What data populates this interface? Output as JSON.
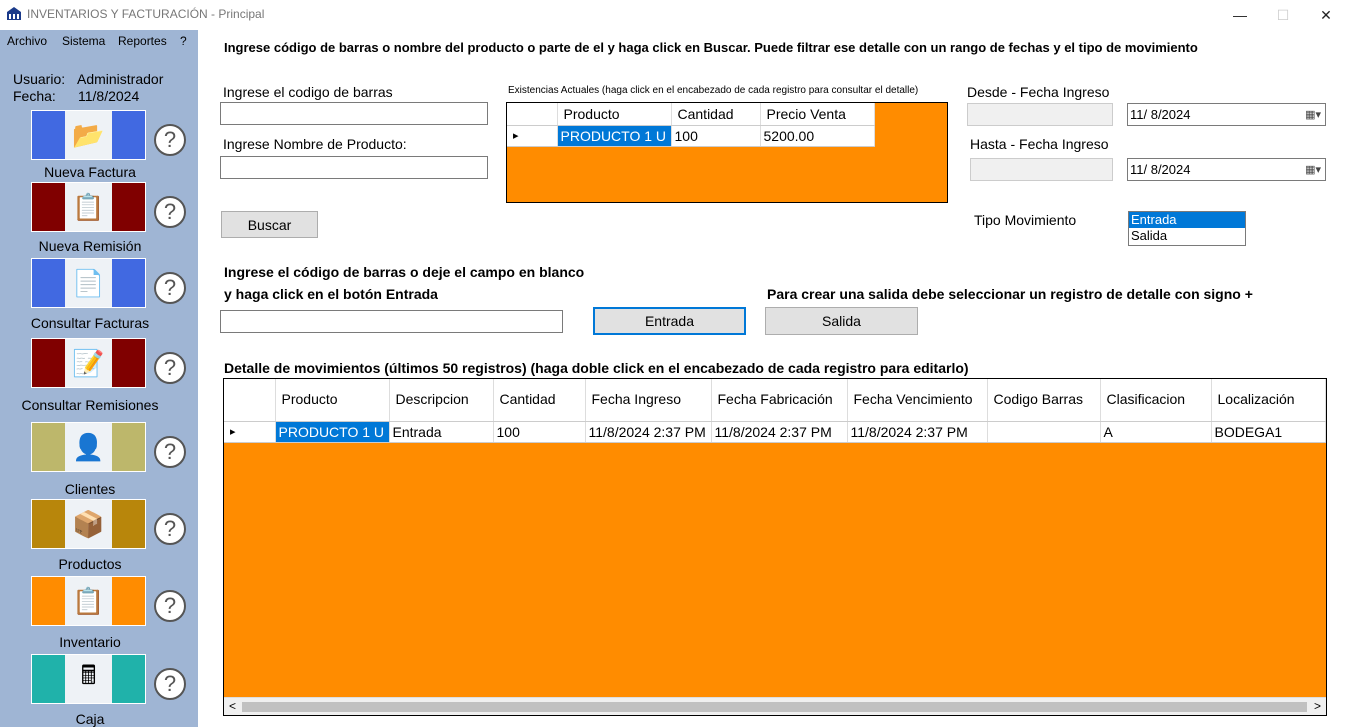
{
  "window": {
    "title": "INVENTARIOS Y FACTURACIÓN - Principal",
    "minimize": "—",
    "maximize": "☐",
    "close": "✕"
  },
  "menu": [
    "Archivo",
    "Sistema",
    "Reportes",
    "?"
  ],
  "user": {
    "user_label": "Usuario:",
    "user_value": "Administrador",
    "date_label": "Fecha:",
    "date_value": "11/8/2024"
  },
  "tiles": [
    {
      "label": "Nueva Factura",
      "color": "#4169e1",
      "icon": "invoice-folder-icon",
      "glyph": "📂"
    },
    {
      "label": "Nueva Remisión",
      "color": "#800000",
      "icon": "notepad-icon",
      "glyph": "📋"
    },
    {
      "label": "Consultar Facturas",
      "color": "#4169e1",
      "icon": "document-form-icon",
      "glyph": "📄"
    },
    {
      "label": "Consultar Remisiones",
      "color": "#800000",
      "icon": "document-pen-icon",
      "glyph": "📝"
    },
    {
      "label": "Clientes",
      "color": "#bdb76b",
      "icon": "client-folder-icon",
      "glyph": "👤"
    },
    {
      "label": "Productos",
      "color": "#b8860b",
      "icon": "box-icon",
      "glyph": "📦"
    },
    {
      "label": "Inventario",
      "color": "#ff8c00",
      "icon": "clipboard-icon",
      "glyph": "📋"
    },
    {
      "label": "Caja",
      "color": "#20b2aa",
      "icon": "cash-register-icon",
      "glyph": "🖩"
    }
  ],
  "help_glyph": "?",
  "instructions": "Ingrese código de barras o nombre del producto o parte de el y haga click en Buscar.  Puede filtrar ese detalle con un rango de fechas y el tipo de movimiento",
  "search": {
    "barcode_label": "Ingrese el codigo de barras",
    "barcode_value": "",
    "name_label": "Ingrese Nombre de Producto:",
    "name_value": "",
    "button": "Buscar"
  },
  "stock": {
    "caption": "Existencias Actuales (haga click en el encabezado de cada registro para consultar el detalle)",
    "columns": [
      "Producto",
      "Cantidad",
      "Precio Venta"
    ],
    "rows": [
      [
        "PRODUCTO 1 U",
        "100",
        "5200.00"
      ]
    ],
    "row_marker": "▸"
  },
  "filters": {
    "from_label": "Desde - Fecha Ingreso",
    "from_date": "11/  8/2024",
    "to_label": "Hasta - Fecha Ingreso",
    "to_date": "11/  8/2024",
    "calendar_glyph": "▦▾",
    "movement_label": "Tipo Movimiento",
    "movement_options": [
      "Entrada",
      "Salida"
    ],
    "movement_selected": "Entrada"
  },
  "entry": {
    "line1": "Ingrese el código de barras o deje el campo en blanco",
    "line2": "y haga click en el botón Entrada",
    "value": "",
    "entry_button": "Entrada",
    "exit_note": "Para crear una salida debe seleccionar un registro de detalle con signo +",
    "exit_button": "Salida"
  },
  "detail": {
    "caption": "Detalle de movimientos (últimos 50 registros) (haga doble click en el encabezado de cada registro para editarlo)",
    "columns": [
      "Producto",
      "Descripcion",
      "Cantidad",
      "Fecha Ingreso",
      "Fecha Fabricación",
      "Fecha Vencimiento",
      "Codigo Barras",
      "Clasificacion",
      "Localización"
    ],
    "rows": [
      [
        "PRODUCTO 1 U",
        "Entrada",
        "100",
        "11/8/2024 2:37 PM",
        "11/8/2024 2:37 PM",
        "11/8/2024 2:37 PM",
        "",
        "A",
        "BODEGA1"
      ]
    ],
    "row_marker": "▸",
    "scroll_left": "<",
    "scroll_right": ">"
  },
  "colors": {
    "sidebar": "#9fb5d4",
    "grid_background": "#ff8c00",
    "selection": "#0078d7"
  }
}
